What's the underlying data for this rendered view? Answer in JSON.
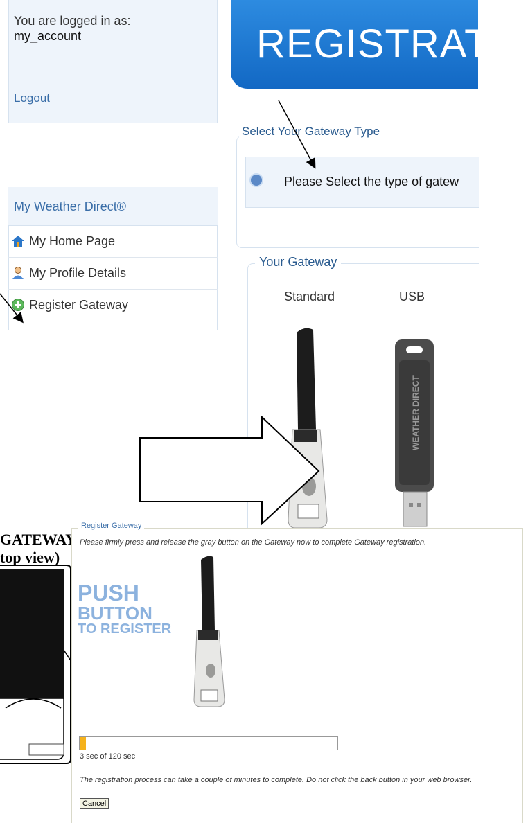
{
  "login": {
    "logged_in_label": "You are logged in as:",
    "username": "my_account",
    "logout": "Logout"
  },
  "menu": {
    "title": "My Weather Direct®",
    "items": [
      {
        "label": "My Home Page",
        "icon": "home-icon"
      },
      {
        "label": "My Profile Details",
        "icon": "user-icon"
      },
      {
        "label": "Register Gateway",
        "icon": "add-icon"
      }
    ]
  },
  "banner": {
    "title": "REGISTRATIO"
  },
  "gateway_type": {
    "legend": "Select Your Gateway Type",
    "info": "Please Select the type of gatew"
  },
  "your_gateway": {
    "legend": "Your Gateway",
    "options": [
      "Standard",
      "USB"
    ]
  },
  "gateway_top_view": {
    "line1": "GATEWAY",
    "line2": "top view)"
  },
  "register_panel": {
    "legend": "Register Gateway",
    "instructions": "Please firmly press and release the gray button on the Gateway now to complete Gateway registration.",
    "push_line1": "PUSH",
    "push_line2": "BUTTON",
    "push_line3": "TO REGISTER",
    "progress_text": "3 sec of 120 sec",
    "progress_fraction": 0.025,
    "note": "The registration process can take a couple of minutes to complete. Do not click the back button in your web browser.",
    "cancel": "Cancel"
  },
  "brand_label": "WEATHER DIRECT",
  "colors": {
    "accent": "#3a6ea8",
    "banner": "#1e7ad6",
    "progress": "#f5b21c"
  }
}
